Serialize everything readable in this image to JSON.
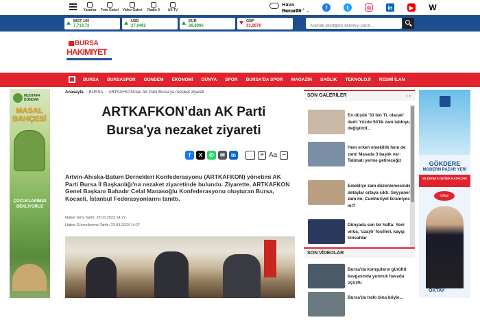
{
  "topnav": {
    "items": [
      {
        "label": "Yazarlar",
        "icon": "users-icon"
      },
      {
        "label": "Foto Galeri",
        "icon": "photo-gallery-icon"
      },
      {
        "label": "Video Galeri",
        "icon": "video-gallery-icon"
      },
      {
        "label": "Radio 5",
        "icon": "radio-icon"
      },
      {
        "label": "AS TV",
        "icon": "tv-icon"
      }
    ]
  },
  "weather": {
    "title": "Hava Durumu",
    "city": "Bursa",
    "temp": "26 °",
    "chevron": "⌄"
  },
  "socials": [
    "f",
    "t",
    "◎",
    "in",
    "▶",
    "W"
  ],
  "currencies": [
    {
      "name": "BIST 100",
      "value": "7.719,72",
      "trend": "up"
    },
    {
      "name": "USD",
      "value": "27,0492",
      "trend": "up"
    },
    {
      "name": "EUR",
      "value": "28,8066",
      "trend": "up"
    },
    {
      "name": "GBP",
      "value": "33,2876",
      "trend": "down"
    }
  ],
  "search": {
    "placeholder": "Aramak istediğiniz kelimeyi yazın..."
  },
  "logo": {
    "line1": "BURSA",
    "line2": "HAKIMIYET"
  },
  "rednav": [
    "BURSA",
    "BURSASPOR",
    "GÜNDEM",
    "EKONOMİ",
    "DÜNYA",
    "SPOR",
    "BURSA'DA SPOR",
    "MAGAZİN",
    "SAĞLIK",
    "TEKNOLOJİ",
    "RESMİ İLAN"
  ],
  "breadcrumb": {
    "home": "Anasayfa",
    "cat": "BURSA",
    "current": "ARTKAFKON'dan AK Parti Bursa'ya nezaket ziyareti",
    "sep": "›"
  },
  "article": {
    "title": "ARTKAFKON’dan AK Parti Bursa'ya nezaket ziyareti",
    "lead": "Artvin-Ahıska-Batum Dernekleri Konfederasyonu (ARTKAFKON) yönetimi AK Parti Bursa İl Başkanlığı'na nezaket ziyaretinde bulundu. Ziyarette, ARTKAFKON Genel Başkanı Bahadır Celal Manasoğlu Konfederasyonu oluşturan Bursa, Kocaeli, İstanbul Federasyonlarını tanıttı.",
    "created": "Haber Giriş Tarihi: 23.03.2023 14:27",
    "updated": "Haber Güncellenme Tarihi: 23.03.2023 14:27",
    "font_label": "Aa"
  },
  "left_ad": {
    "brand": "MUSTAFA DÜNDAR",
    "title": "MASAL BAHÇESİ",
    "slogan": "ÇOCUKLARIMIZI BEKLİYORUZ"
  },
  "right_ad": {
    "title": "GÖKDERE",
    "subtitle": "MODERN PAZAR YERİ",
    "band": "YILDIRIM'A DEĞER KATACAK!",
    "sign": "Oktay",
    "name": "OKTAY"
  },
  "gallery": {
    "title": "SON GALERİLER",
    "nav": "‹ ›",
    "items": [
      {
        "text": "En düşük '33 bin TL olacak' dedi: Yüzde 50'lik zam tabloyu değiştirdi...",
        "color": "#c9b8a6"
      },
      {
        "text": "Hem erken emeklilik hem de zam! Masada 3 başlık var: Talimatı yerine getireceğiz",
        "color": "#7a8ea6"
      },
      {
        "text": "Emekliye zam düzenlemesinde detaylar ortaya çıktı: Seyyanen zam mı, Cumhuriyet ikramiyesi mi?",
        "color": "#b99f82"
      },
      {
        "text": "Dünyada son bir hafta: Yeni virüs, 'uzaylı' fosilleri, kayıp timsahlar",
        "color": "#2a3a5e"
      }
    ]
  },
  "videos": {
    "title": "SON VİDEOLAR",
    "items": [
      {
        "text": "Bursa'da komşuların gürültü kavgasında yumruk havada uçuştu",
        "color": "#4a5a66"
      },
      {
        "text": "Bursa'da trafo bina böyle...",
        "color": "#6a7a80"
      }
    ]
  },
  "colors": {
    "brand_red": "#e1232e",
    "brand_blue": "#1d4e8f"
  }
}
